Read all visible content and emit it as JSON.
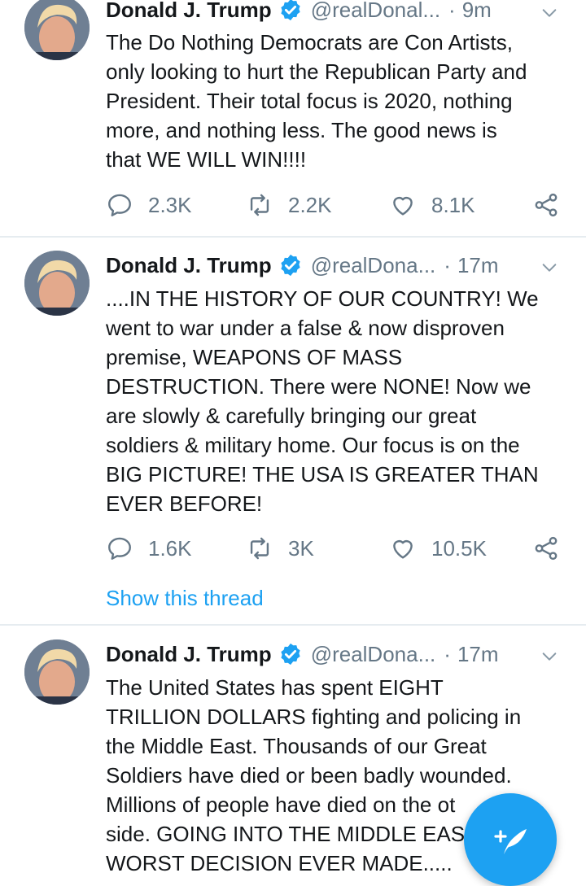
{
  "tweets": [
    {
      "name": "Donald J. Trump",
      "handle": "@realDonal...",
      "time": "9m",
      "lines": [
        "The Do Nothing Democrats are Con Artists,",
        "only looking to hurt the Republican Party and",
        "President. Their total focus is 2020, nothing",
        "more, and nothing less. The good news is",
        "that WE WILL WIN!!!!"
      ],
      "replies": "2.3K",
      "retweets": "2.2K",
      "likes": "8.1K"
    },
    {
      "name": "Donald J. Trump",
      "handle": "@realDona...",
      "time": "17m",
      "lines": [
        "....IN THE HISTORY OF OUR COUNTRY! We",
        "went to war under a false & now disproven",
        "premise, WEAPONS OF MASS",
        "DESTRUCTION. There were NONE! Now we",
        "are slowly & carefully bringing our great",
        "soldiers & military home. Our focus is on the",
        "BIG PICTURE! THE USA IS GREATER THAN",
        "EVER BEFORE!"
      ],
      "replies": "1.6K",
      "retweets": "3K",
      "likes": "10.5K",
      "show_thread": "Show this thread"
    },
    {
      "name": "Donald J. Trump",
      "handle": "@realDona...",
      "time": "17m",
      "lines": [
        "The United States has spent EIGHT",
        "TRILLION DOLLARS fighting and policing in",
        "the Middle East. Thousands of our Great",
        "Soldiers have died or been badly wounded.",
        "Millions of people have died on the ot",
        "side. GOING INTO THE MIDDLE EAS",
        "WORST DECISION EVER MADE....."
      ]
    }
  ],
  "separator": "·",
  "colors": {
    "accent": "#1da1f2",
    "secondary_text": "#657786",
    "divider": "#e6ecf0"
  },
  "icons": {
    "reply": "reply-icon",
    "retweet": "retweet-icon",
    "like": "heart-icon",
    "share": "share-icon",
    "menu": "chevron-down-icon",
    "verified": "verified-badge-icon",
    "compose": "compose-tweet-icon"
  }
}
